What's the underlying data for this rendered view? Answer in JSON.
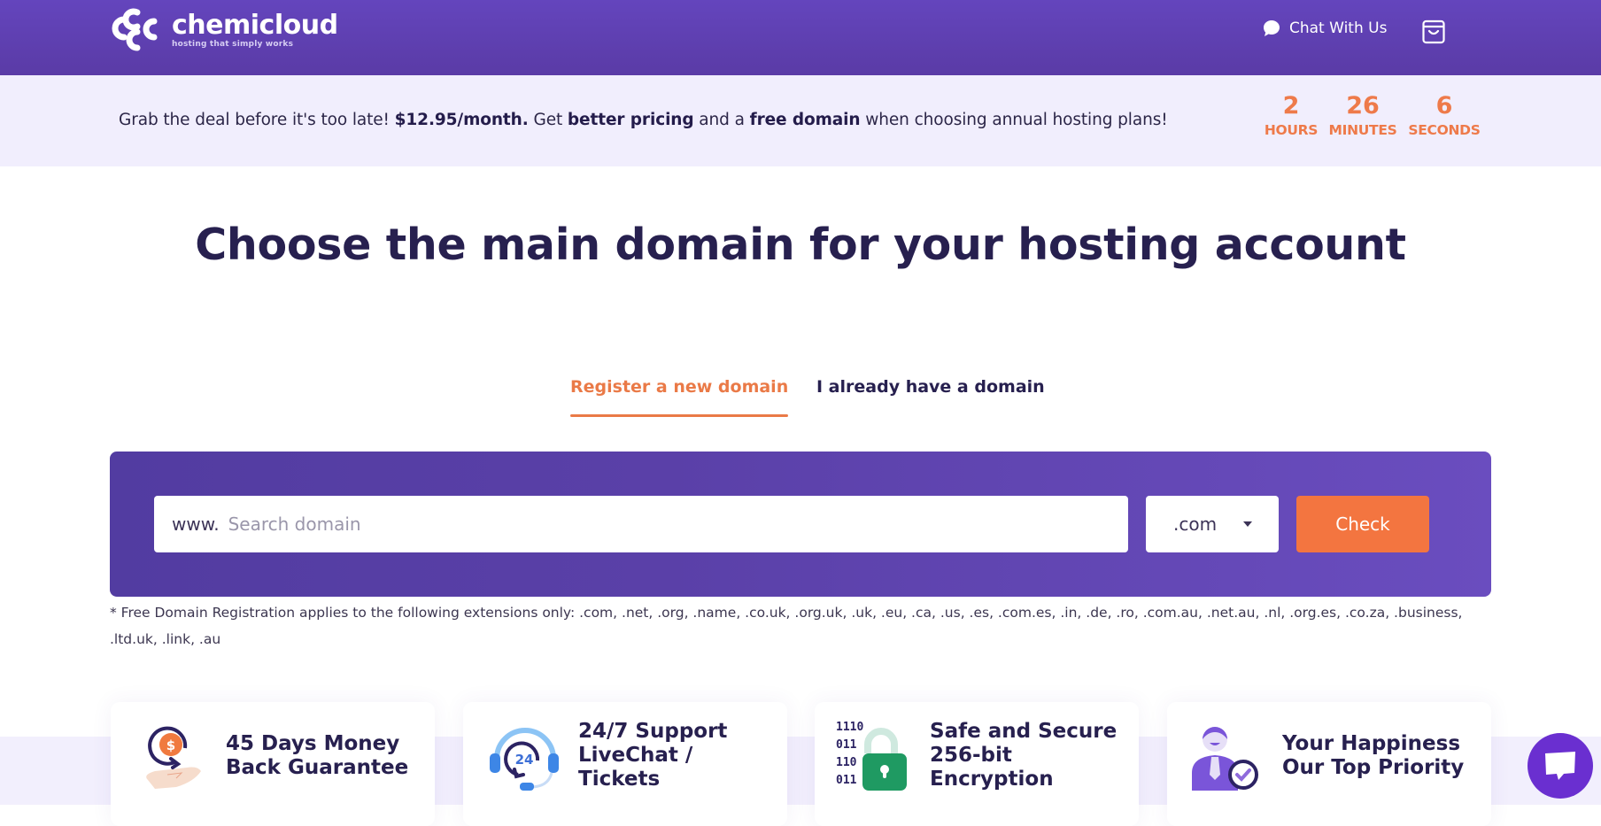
{
  "header": {
    "logo": {
      "name": "chemicloud",
      "tagline": "hosting that simply works"
    },
    "chat_label": "Chat With Us",
    "cart_icon": "shopping-bag-icon"
  },
  "promo": {
    "text_1": "Grab the deal before it's too late! ",
    "price": "$12.95/month.",
    "text_2": " Get ",
    "bold_1": "better pricing",
    "text_3": " and a ",
    "bold_2": "free domain",
    "text_4": " when choosing annual hosting plans!",
    "countdown": [
      {
        "value": "2",
        "unit": "HOURS"
      },
      {
        "value": "26",
        "unit": "MINUTES"
      },
      {
        "value": "6",
        "unit": "SECONDS"
      }
    ]
  },
  "main": {
    "title": "Choose the main domain for your hosting account",
    "tabs": [
      {
        "label": "Register a new domain",
        "active": true
      },
      {
        "label": "I already have a domain",
        "active": false
      }
    ],
    "search": {
      "prefix": "www.",
      "value": "",
      "placeholder": "Search domain",
      "tld_selected": ".com",
      "check_label": "Check"
    },
    "footnote": "* Free Domain Registration applies to the following extensions only: .com, .net, .org, .name, .co.uk, .org.uk, .uk, .eu, .ca, .us, .es, .com.es, .in, .de, .ro, .com.au, .net.au, .nl, .org.es, .co.za, .business, .ltd.uk, .link, .au"
  },
  "features": [
    {
      "icon": "money-back-icon",
      "lines": [
        "45 Days Money",
        "Back Guarantee"
      ]
    },
    {
      "icon": "support-headset-icon",
      "lines": [
        "24/7 Support",
        "LiveChat /",
        "Tickets"
      ]
    },
    {
      "icon": "padlock-icon",
      "lines": [
        "Safe and Secure",
        "256-bit",
        "Encryption"
      ]
    },
    {
      "icon": "happy-customer-icon",
      "lines": [
        "Your Happiness",
        "Our Top Priority"
      ]
    }
  ],
  "colors": {
    "brand_purple": "#5a3ba6",
    "accent_orange": "#f37540",
    "heading_navy": "#27204f",
    "promo_bg": "#f1eefd"
  }
}
